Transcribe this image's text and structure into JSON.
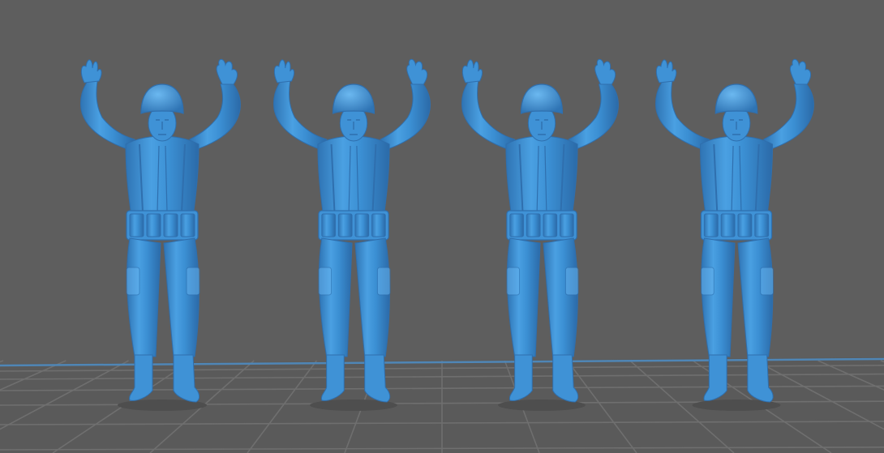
{
  "viewport": {
    "background_color": "#5e5e5e",
    "grid_color": "#6f6f6f",
    "grid_edge_color": "#4f86b6",
    "model_color": "#3f92d6",
    "model_shadow_color": "#2f6fae",
    "model_highlight_color": "#66b3ef"
  },
  "models": [
    {
      "name": "soldier-figure-1"
    },
    {
      "name": "soldier-figure-2"
    },
    {
      "name": "soldier-figure-3"
    },
    {
      "name": "soldier-figure-4"
    }
  ]
}
